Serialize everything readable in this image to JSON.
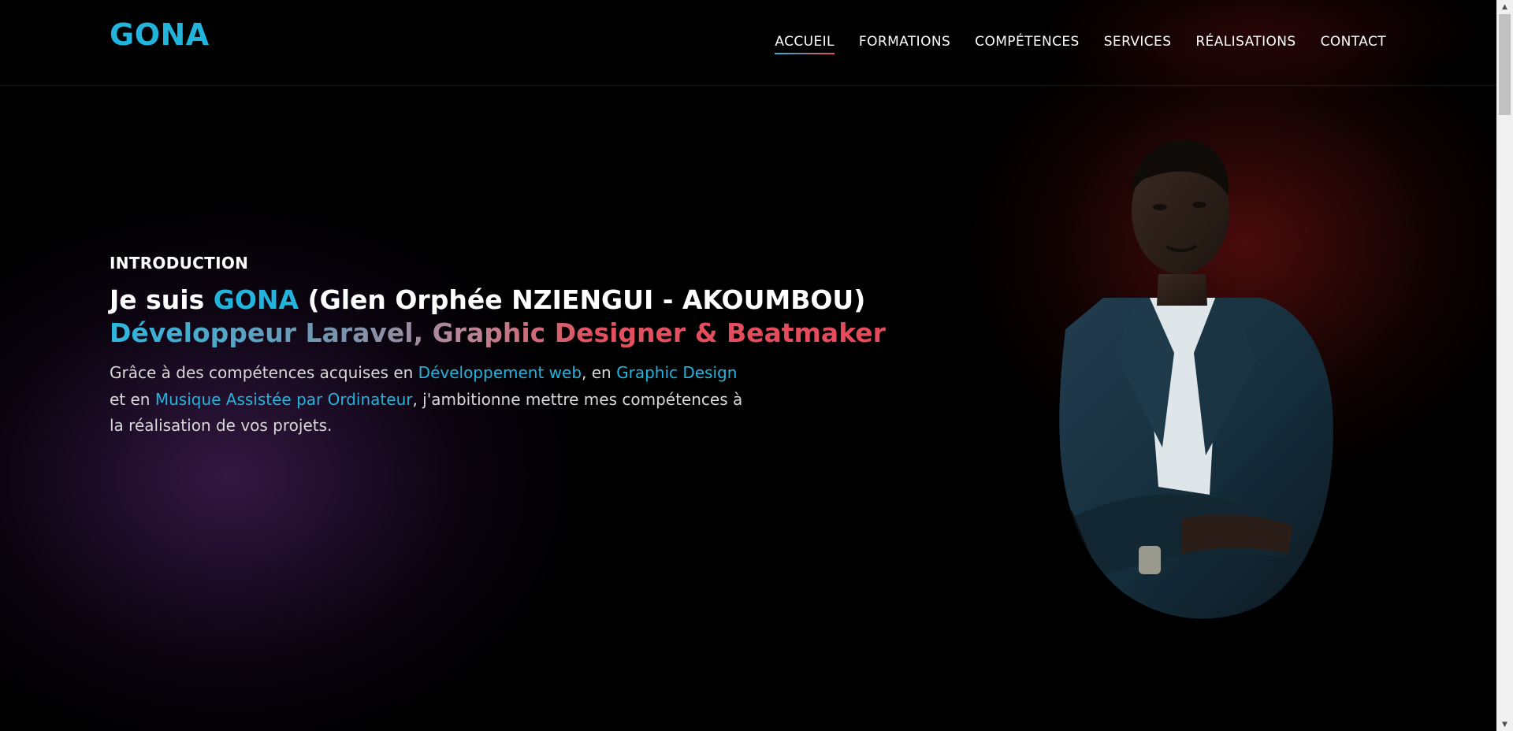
{
  "header": {
    "logo": "GONA",
    "nav": [
      {
        "label": "ACCUEIL",
        "active": true
      },
      {
        "label": "FORMATIONS"
      },
      {
        "label": "COMPÉTENCES"
      },
      {
        "label": "SERVICES"
      },
      {
        "label": "RÉALISATIONS"
      },
      {
        "label": "CONTACT"
      }
    ]
  },
  "intro": {
    "eyebrow": "INTRODUCTION",
    "headline_prefix": "Je suis ",
    "headline_name": "GONA",
    "headline_suffix": " (Glen Orphée NZIENGUI - AKOUMBOU)",
    "roles": "Développeur Laravel, Graphic Designer & Beatmaker",
    "desc": {
      "t1": "Grâce à des compétences acquises en ",
      "hl1": "Développement web",
      "t2": ", en ",
      "hl2": "Graphic Design",
      "t3": " et en ",
      "hl3": "Musique Assistée par Ordinateur",
      "t4": ", j'ambitionne mettre mes compétences à la réalisation de vos projets."
    }
  },
  "colors": {
    "accent": "#21b4dc",
    "accent_red": "#e64a5a",
    "background": "#000000"
  },
  "icons": {
    "scroll_up": "▲",
    "scroll_down": "▼"
  }
}
